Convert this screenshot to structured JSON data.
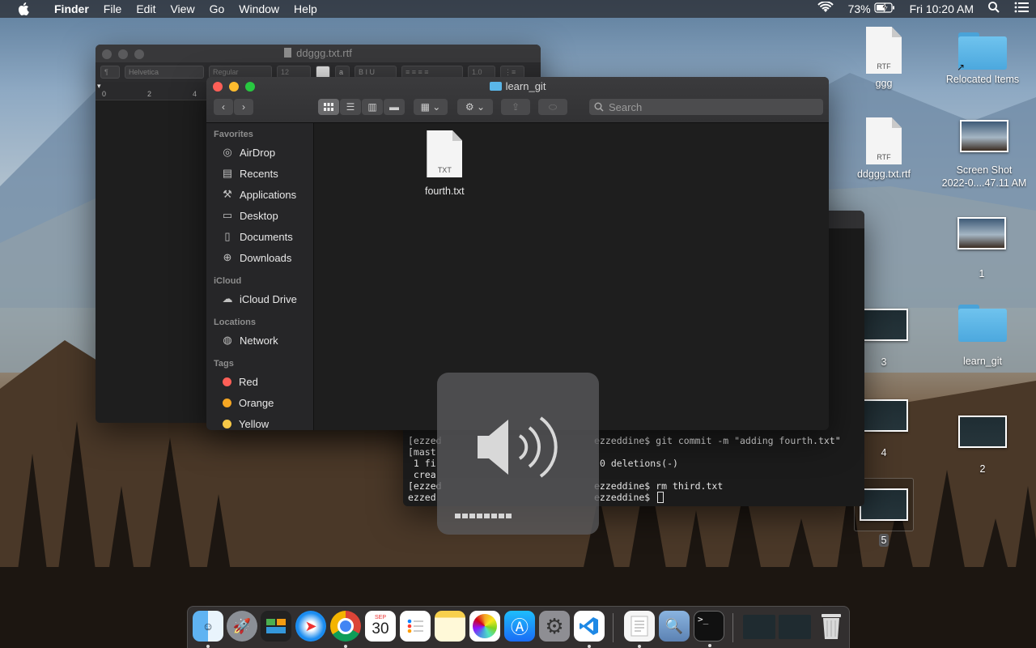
{
  "menubar": {
    "app_name": "Finder",
    "menus": [
      "File",
      "Edit",
      "View",
      "Go",
      "Window",
      "Help"
    ],
    "battery": "73%",
    "clock": "Fri 10:20 AM"
  },
  "textedit": {
    "title": "ddggg.txt.rtf",
    "style_button": "¶",
    "font": "Helvetica",
    "weight": "Regular",
    "size": "12",
    "line_spacing": "1.0",
    "ruler_marks": [
      "0",
      "2",
      "4"
    ]
  },
  "terminal": {
    "lines": [
      "[ezzed",
      "[mast",
      " 1 fi",
      " crea",
      "[ezzed",
      "ezzed"
    ],
    "right_fragments": [
      "ezzeddine$ git commit -m \"adding fourth.txt\"",
      "",
      "0 deletions(-)",
      "",
      "ezzeddine$ rm third.txt",
      "ezzeddine$ "
    ]
  },
  "finder": {
    "title": "learn_git",
    "search_placeholder": "Search",
    "sidebar": {
      "favorites_header": "Favorites",
      "favorites": [
        "AirDrop",
        "Recents",
        "Applications",
        "Desktop",
        "Documents",
        "Downloads"
      ],
      "icloud_header": "iCloud",
      "icloud": [
        "iCloud Drive"
      ],
      "locations_header": "Locations",
      "locations": [
        "Network"
      ],
      "tags_header": "Tags",
      "tags": [
        {
          "label": "Red",
          "color": "#fe5f57"
        },
        {
          "label": "Orange",
          "color": "#f5a623"
        },
        {
          "label": "Yellow",
          "color": "#f7c948"
        }
      ]
    },
    "files": [
      {
        "name": "fourth.txt",
        "ext": "TXT"
      }
    ]
  },
  "desktop": {
    "icons": [
      {
        "label": "ggg",
        "kind": "doc",
        "ext": "RTF"
      },
      {
        "label": "Relocated Items",
        "kind": "folder"
      },
      {
        "label": "ddggg.txt.rtf",
        "kind": "doc",
        "ext": "RTF"
      },
      {
        "label": "Screen Shot\n2022-0....47.11 AM",
        "kind": "image"
      },
      {
        "label": "1",
        "kind": "image"
      },
      {
        "label": "3",
        "kind": "image"
      },
      {
        "label": "learn_git",
        "kind": "folder"
      },
      {
        "label": "4",
        "kind": "image"
      },
      {
        "label": "2",
        "kind": "image"
      },
      {
        "label": "5",
        "kind": "image"
      }
    ]
  },
  "calendar_badge": {
    "month": "SEP",
    "day": "30"
  },
  "dock": {
    "apps": [
      "finder",
      "launchpad",
      "mission-control",
      "safari",
      "chrome",
      "calendar",
      "reminders",
      "notes",
      "photos",
      "app-store",
      "system-preferences",
      "vscode",
      "textedit",
      "preview",
      "terminal"
    ]
  },
  "colors": {
    "accent": "#2f8cf0",
    "folder_blue": "#5ab6e8"
  }
}
